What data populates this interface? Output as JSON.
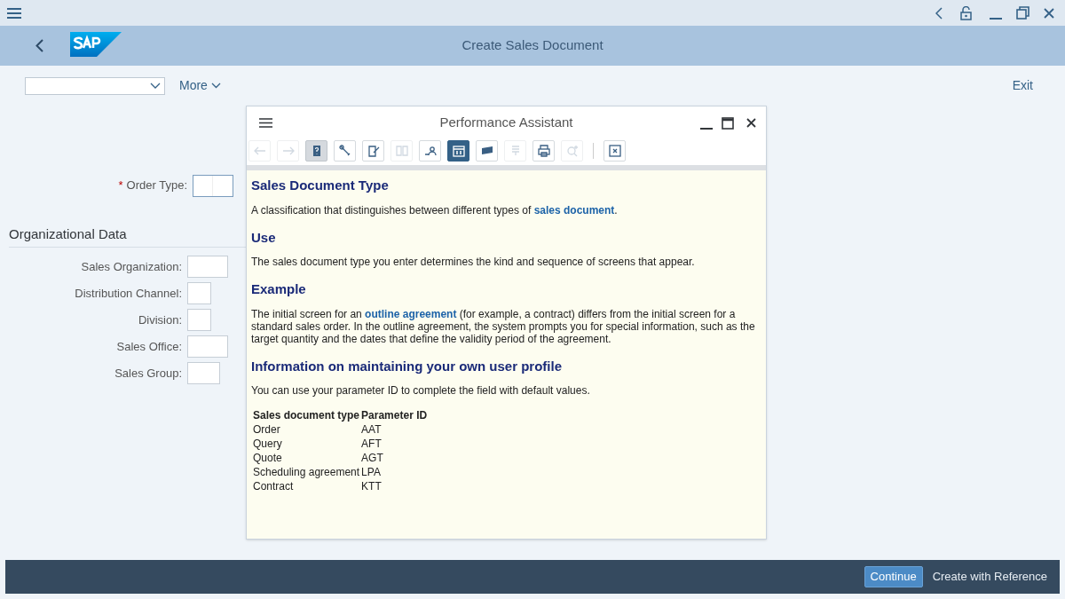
{
  "window": {
    "title": "Create Sales Document"
  },
  "toolbar": {
    "more": "More",
    "exit": "Exit"
  },
  "form": {
    "order_type": {
      "marker": "*",
      "label": "Order Type:"
    },
    "section_title": "Organizational Data",
    "fields": [
      {
        "label": "Sales Organization:"
      },
      {
        "label": "Distribution Channel:"
      },
      {
        "label": "Division:"
      },
      {
        "label": "Sales Office:"
      },
      {
        "label": "Sales Group:"
      }
    ]
  },
  "dialog": {
    "title": "Performance Assistant",
    "tools": [
      {
        "selected": false,
        "disabled": true
      },
      {
        "selected": false,
        "disabled": true
      },
      {
        "selected": true,
        "disabled": false,
        "kind": "pressed"
      },
      {
        "selected": false,
        "disabled": false
      },
      {
        "selected": false,
        "disabled": false
      },
      {
        "selected": false,
        "disabled": true
      },
      {
        "selected": false,
        "disabled": false
      },
      {
        "selected": true,
        "disabled": false,
        "kind": "active"
      },
      {
        "selected": false,
        "disabled": false
      },
      {
        "selected": false,
        "disabled": true
      },
      {
        "selected": false,
        "disabled": false
      },
      {
        "selected": false,
        "disabled": true
      },
      {
        "selected": false,
        "disabled": false
      }
    ],
    "blocks": [
      {
        "kind": "heading",
        "text": "Sales Document Type"
      },
      {
        "kind": "paragraph",
        "parts": [
          {
            "text": "A classification that distinguishes between different types of "
          },
          {
            "text": "sales document",
            "link": true
          },
          {
            "text": "."
          }
        ]
      },
      {
        "kind": "heading",
        "text": "Use"
      },
      {
        "kind": "paragraph",
        "parts": [
          {
            "text": "The sales document type you enter determines the kind and sequence of screens that appear."
          }
        ]
      },
      {
        "kind": "heading",
        "text": "Example"
      },
      {
        "kind": "paragraph",
        "parts": [
          {
            "text": "The initial screen for an "
          },
          {
            "text": "outline agreement",
            "link": true
          },
          {
            "text": " (for example, a contract) differs from the initial screen for a standard sales order. In the outline agreement, the system prompts you for special information, such as the target quantity and the dates that define the validity period of the agreement."
          }
        ]
      },
      {
        "kind": "heading",
        "text": "Information on maintaining your own user profile"
      },
      {
        "kind": "paragraph",
        "parts": [
          {
            "text": "You can use your parameter ID to complete the field with default values."
          }
        ]
      },
      {
        "kind": "table",
        "columns": [
          "Sales document type",
          "Parameter ID"
        ],
        "rows": [
          [
            "Order",
            "AAT"
          ],
          [
            "Query",
            "AFT"
          ],
          [
            "Quote",
            "AGT"
          ],
          [
            "Scheduling agreement",
            "LPA"
          ],
          [
            "Contract",
            "KTT"
          ]
        ]
      }
    ]
  },
  "footer": {
    "buttons": [
      {
        "label": "Continue",
        "primary": true
      },
      {
        "label": "Create with Reference",
        "primary": false
      }
    ]
  }
}
